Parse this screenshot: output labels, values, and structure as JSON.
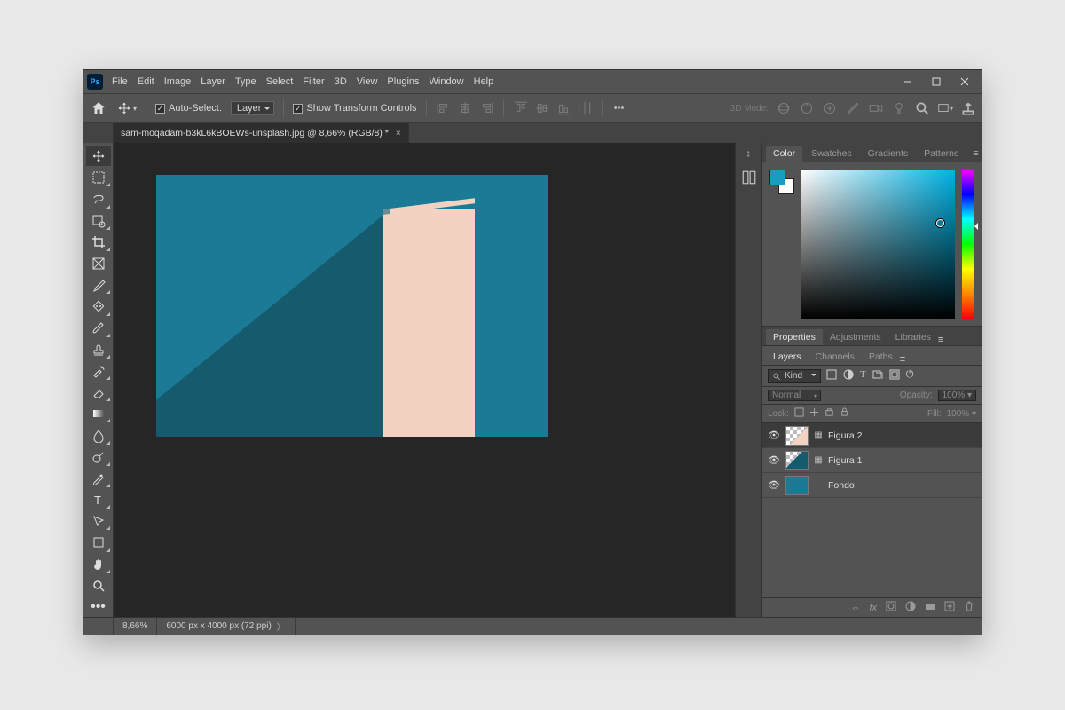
{
  "app": {
    "logo_text": "Ps"
  },
  "menu": [
    "File",
    "Edit",
    "Image",
    "Layer",
    "Type",
    "Select",
    "Filter",
    "3D",
    "View",
    "Plugins",
    "Window",
    "Help"
  ],
  "optionsbar": {
    "auto_select_label": "Auto-Select:",
    "auto_select_scope": "Layer",
    "show_transform_label": "Show Transform Controls",
    "threeD_label": "3D Mode:"
  },
  "document": {
    "tab_title": "sam-moqadam-b3kL6kBOEWs-unsplash.jpg @ 8,66% (RGB/8) *"
  },
  "status": {
    "zoom": "8,66%",
    "dims": "6000 px x 4000 px (72 ppi)"
  },
  "tools": [
    "move",
    "marquee",
    "lasso",
    "wand",
    "crop",
    "frame",
    "eyedropper",
    "healing",
    "brush",
    "stamp",
    "history",
    "eraser",
    "gradient",
    "blur",
    "dodge",
    "pen",
    "type",
    "path",
    "rectangle",
    "hand",
    "zoom",
    "more"
  ],
  "colorPanel": {
    "tabs": [
      "Color",
      "Swatches",
      "Gradients",
      "Patterns"
    ],
    "active_tab": "Color",
    "foreground": "#1b9bc0",
    "background": "#ffffff"
  },
  "midPanel": {
    "tabs": [
      "Properties",
      "Adjustments",
      "Libraries"
    ],
    "active_tab": "Properties"
  },
  "layersPanel": {
    "tabs": [
      "Layers",
      "Channels",
      "Paths"
    ],
    "active_tab": "Layers",
    "kind_label": "Kind",
    "blend_mode": "Normal",
    "opacity_label": "Opacity:",
    "opacity_value": "100%",
    "lock_label": "Lock:",
    "fill_label": "Fill:",
    "fill_value": "100%",
    "layers": [
      {
        "name": "Figura 2",
        "visible": true,
        "thumb": "checker-pillar",
        "smart": true
      },
      {
        "name": "Figura 1",
        "visible": true,
        "thumb": "checker-shadow",
        "smart": true
      },
      {
        "name": "Fondo",
        "visible": true,
        "thumb": "solid-teal",
        "smart": false
      }
    ]
  },
  "search_placeholder": "Kind"
}
